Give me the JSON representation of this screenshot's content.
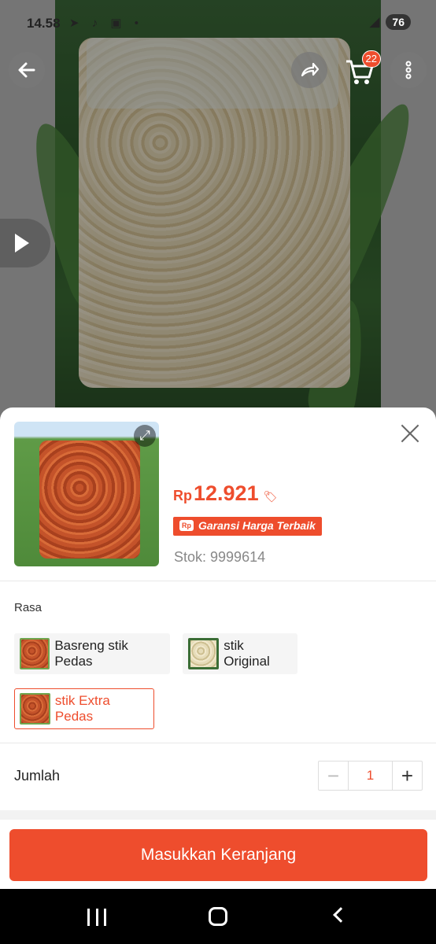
{
  "status_bar": {
    "time": "14.58",
    "battery": "76"
  },
  "cart": {
    "badge": "22"
  },
  "product_sheet": {
    "price_currency": "Rp",
    "price_amount": "12.921",
    "guarantee_label": "Garansi Harga Terbaik",
    "guarantee_icon_text": "Rp",
    "stock_label": "Stok: 9999614"
  },
  "variation": {
    "label": "Rasa",
    "options": [
      {
        "label": "Basreng stik Pedas",
        "selected": false
      },
      {
        "label": "stik Original",
        "selected": false
      },
      {
        "label": "stik Extra Pedas",
        "selected": true
      }
    ]
  },
  "quantity": {
    "label": "Jumlah",
    "value": "1",
    "minus": "−",
    "plus": "+"
  },
  "add_to_cart_label": "Masukkan Keranjang",
  "colors": {
    "accent": "#ee4d2d"
  }
}
